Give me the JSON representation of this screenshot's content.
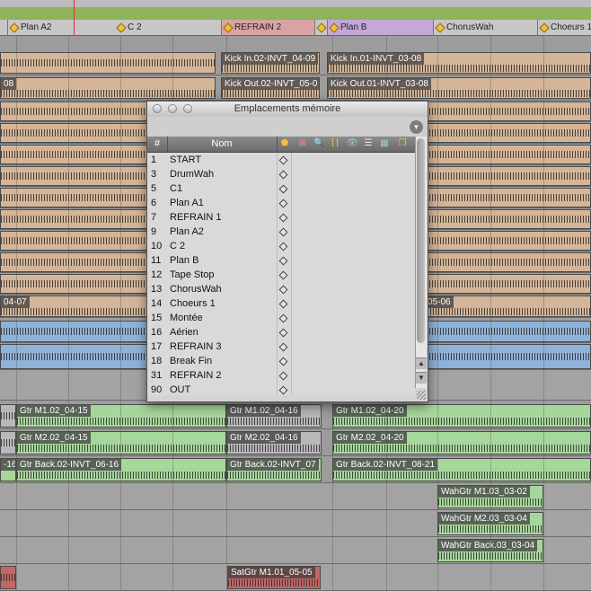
{
  "markers": [
    {
      "label": "Plan A2"
    },
    {
      "label": "C 2"
    },
    {
      "label": "REFRAIN 2"
    },
    {
      "label": "Plan B"
    },
    {
      "label": "ChorusWah"
    },
    {
      "label": "Choeurs 1"
    }
  ],
  "clips": {
    "kick_in_02": "Kick In.02-INVT_04-09",
    "kick_in_01": "Kick In.01-INVT_03-08",
    "kick_out_prev": "08",
    "kick_out_02": "Kick Out.02-INVT_05-0",
    "kick_out_01": "Kick Out.01-INVT_03-08",
    "bass_prev": "04-07",
    "bass_next": "05-06",
    "gtr_m1_a": "Gtr M1.02_04-15",
    "gtr_m1_b": "Gtr M1.02_04-16",
    "gtr_m1_c": "Gtr M1.02_04-20",
    "gtr_m2_a": "Gtr M2.02_04-15",
    "gtr_m2_b": "Gtr M2.02_04-16",
    "gtr_m2_c": "Gtr M2.02_04-20",
    "gtr_back_prev": "-16",
    "gtr_back_a": "Gtr Back.02-INVT_06-16",
    "gtr_back_b": "Gtr Back.02-INVT_07",
    "gtr_back_c": "Gtr Back.02-INVT_08-21",
    "wah_m1": "WahGtr M1.03_03-02",
    "wah_m2": "WahGtr M2.03_03-04",
    "wah_back": "WahGtr Back.03_03-04",
    "sat_m1": "SatGtr M1.01_05-05"
  },
  "window": {
    "title": "Emplacements mémoire",
    "col_num": "#",
    "col_name": "Nom",
    "rows": [
      {
        "num": "1",
        "name": "START"
      },
      {
        "num": "3",
        "name": "DrumWah"
      },
      {
        "num": "5",
        "name": "C1"
      },
      {
        "num": "6",
        "name": "Plan A1"
      },
      {
        "num": "7",
        "name": "REFRAIN 1"
      },
      {
        "num": "9",
        "name": "Plan A2"
      },
      {
        "num": "10",
        "name": "C 2"
      },
      {
        "num": "11",
        "name": "Plan B"
      },
      {
        "num": "12",
        "name": "Tape Stop"
      },
      {
        "num": "13",
        "name": "ChorusWah"
      },
      {
        "num": "14",
        "name": "Choeurs 1"
      },
      {
        "num": "15",
        "name": "Montée"
      },
      {
        "num": "16",
        "name": "Aérien"
      },
      {
        "num": "17",
        "name": "REFRAIN 3"
      },
      {
        "num": "18",
        "name": "Break Fin"
      },
      {
        "num": "31",
        "name": "REFRAIN 2"
      },
      {
        "num": "90",
        "name": "OUT"
      }
    ]
  },
  "colors": {
    "audio_tan": "#d5b597",
    "audio_blue": "#8fb2d8",
    "audio_green": "#a6d79a",
    "audio_red": "#c26666",
    "marker_bar": "#c7c7c7",
    "ruler_green": "#8db35b"
  }
}
